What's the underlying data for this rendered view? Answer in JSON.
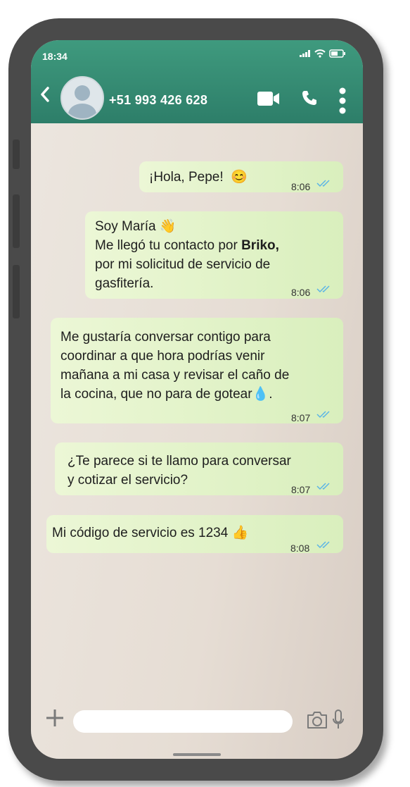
{
  "status_bar": {
    "time": "18:34"
  },
  "header": {
    "contact_name": "+51 993 426 628"
  },
  "icons": {
    "back": "chevron-left-icon",
    "avatar": "default-avatar-icon",
    "video": "video-camera-icon",
    "call": "phone-icon",
    "menu": "more-vertical-icon",
    "plus": "plus-icon",
    "camera": "camera-icon",
    "mic": "microphone-icon",
    "ticks": "double-check-icon"
  },
  "messages": [
    {
      "lines": [
        "¡Hola, Pepe!  😊"
      ],
      "time": "8:06"
    },
    {
      "lines": [
        "Soy María 👋",
        "Me llegó tu contacto por ",
        "por mi solicitud de servicio de",
        "gasfitería."
      ],
      "bold": "Briko,",
      "time": "8:06"
    },
    {
      "lines": [
        "Me gustaría conversar contigo para",
        "coordinar a que hora podrías venir",
        "mañana a mi casa y revisar el caño de",
        "la cocina, que no para de gotear💧."
      ],
      "time": "8:07"
    },
    {
      "lines": [
        "¿Te parece si te llamo para conversar",
        "y cotizar el servicio?"
      ],
      "time": "8:07"
    },
    {
      "lines": [
        "Mi código de servicio es 1234 👍"
      ],
      "time": "8:08"
    }
  ],
  "colors": {
    "header": "#2d7e69",
    "bubble": "#dcf8c6",
    "ticks": "#5ab4e6"
  }
}
